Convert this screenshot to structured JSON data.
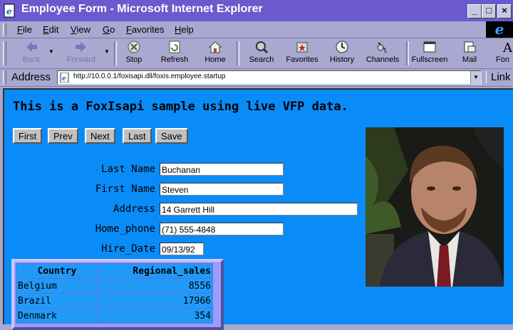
{
  "window": {
    "title": "Employee Form - Microsoft Internet Explorer",
    "controls": [
      "_",
      "□",
      "×"
    ]
  },
  "menu": {
    "items": [
      {
        "accel": "F",
        "rest": "ile"
      },
      {
        "accel": "E",
        "rest": "dit"
      },
      {
        "accel": "V",
        "rest": "iew"
      },
      {
        "accel": "G",
        "rest": "o"
      },
      {
        "accel": "F",
        "rest": "avorites",
        "prefix": ""
      },
      {
        "accel": "H",
        "rest": "elp"
      }
    ],
    "labels": [
      "File",
      "Edit",
      "View",
      "Go",
      "Favorites",
      "Help"
    ]
  },
  "toolbar": {
    "back": "Back",
    "forward": "Forward",
    "stop": "Stop",
    "refresh": "Refresh",
    "home": "Home",
    "search": "Search",
    "favorites": "Favorites",
    "history": "History",
    "channels": "Channels",
    "fullscreen": "Fullscreen",
    "mail": "Mail",
    "font": "Fon"
  },
  "address": {
    "label": "Address",
    "url": "http://10.0.0.1/foxisapi.dll/foxis.employee.startup",
    "links_label": "Link"
  },
  "page": {
    "heading": "This is a FoxIsapi sample using live VFP data.",
    "buttons": {
      "first": "First",
      "prev": "Prev",
      "next": "Next",
      "last": "Last",
      "save": "Save"
    },
    "fields": {
      "last_name": {
        "label": "Last Name",
        "value": "Buchanan"
      },
      "first_name": {
        "label": "First Name",
        "value": "Steven"
      },
      "address": {
        "label": "Address",
        "value": "14 Garrett Hill"
      },
      "home_phone": {
        "label": "Home_phone",
        "value": "(71) 555-4848"
      },
      "hire_date": {
        "label": "Hire_Date",
        "value": "09/13/92"
      }
    },
    "table": {
      "headers": [
        "Country",
        "Regional_sales"
      ],
      "rows": [
        [
          "Belgium",
          "8556"
        ],
        [
          "Brazil",
          "17966"
        ],
        [
          "Denmark",
          "354"
        ]
      ]
    }
  }
}
